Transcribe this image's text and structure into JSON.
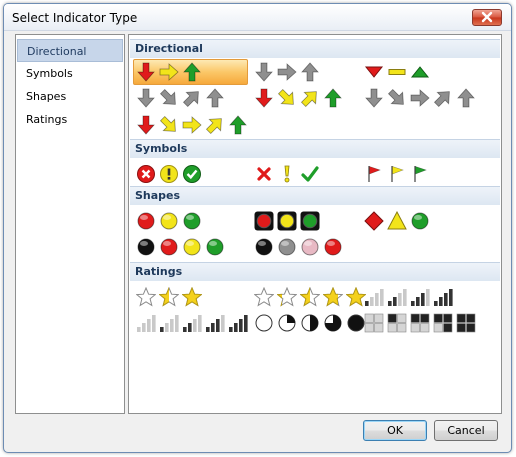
{
  "dialog": {
    "title": "Select Indicator Type"
  },
  "sidebar": {
    "items": [
      {
        "label": "Directional",
        "selected": true
      },
      {
        "label": "Symbols"
      },
      {
        "label": "Shapes"
      },
      {
        "label": "Ratings"
      }
    ]
  },
  "sections": [
    {
      "label": "Directional"
    },
    {
      "label": "Symbols"
    },
    {
      "label": "Shapes"
    },
    {
      "label": "Ratings"
    }
  ],
  "icon_sets": {
    "directional": [
      [
        "arrow-down-red",
        "arrow-right-yellow",
        "arrow-up-green"
      ],
      [
        "arrow-down-gray",
        "arrow-right-gray",
        "arrow-up-gray"
      ],
      [
        "triangle-down-red",
        "dash-yellow",
        "triangle-up-green"
      ],
      [
        "arrow-down-gray",
        "arrow-down-right-gray",
        "arrow-up-right-gray",
        "arrow-up-gray"
      ],
      [
        "arrow-down-red",
        "arrow-down-right-yellow",
        "arrow-up-right-yellow",
        "arrow-up-green"
      ],
      [
        "arrow-down-gray",
        "arrow-down-right-gray",
        "arrow-right-gray",
        "arrow-up-right-gray",
        "arrow-up-gray"
      ],
      [
        "arrow-down-red",
        "arrow-down-right-yellow",
        "arrow-right-yellow",
        "arrow-up-right-yellow",
        "arrow-up-green"
      ]
    ],
    "symbols": [
      [
        "circle-x-red",
        "circle-exclamation-yellow",
        "circle-check-green"
      ],
      [
        "x-red",
        "exclamation-yellow",
        "check-green"
      ],
      [
        "flag-red",
        "flag-yellow",
        "flag-green"
      ]
    ],
    "shapes": [
      [
        "circle-red",
        "circle-yellow",
        "circle-green"
      ],
      [
        "traffic-light-red",
        "traffic-light-yellow",
        "traffic-light-green"
      ],
      [
        "diamond-red",
        "triangle-yellow",
        "circle-green"
      ],
      [
        "circle-black",
        "circle-red",
        "circle-yellow",
        "circle-green"
      ],
      [
        "circle-black",
        "circle-gray",
        "circle-pink",
        "circle-red"
      ]
    ],
    "ratings": [
      [
        "star-empty",
        "star-half",
        "star-full"
      ],
      [
        "star-empty",
        "star-quarter",
        "star-half",
        "star-three-quarter",
        "star-full"
      ],
      [
        "bars-1",
        "bars-2",
        "bars-3",
        "bars-4"
      ],
      [
        "bars-0",
        "bars-1",
        "bars-2",
        "bars-3",
        "bars-4"
      ],
      [
        "quarters-0",
        "quarters-1",
        "quarters-2",
        "quarters-3",
        "quarters-4"
      ],
      [
        "boxes-0",
        "boxes-1",
        "boxes-2",
        "boxes-3",
        "boxes-4"
      ]
    ]
  },
  "selected_set": "directional-3-colored-arrows",
  "colors": {
    "red": "#e01b1b",
    "yellow": "#f2e41a",
    "green": "#1f9e2a",
    "gray": "#8f8f8f",
    "accent": "#f6a93c",
    "section_text": "#1e395b"
  },
  "buttons": {
    "ok": "OK",
    "cancel": "Cancel"
  }
}
